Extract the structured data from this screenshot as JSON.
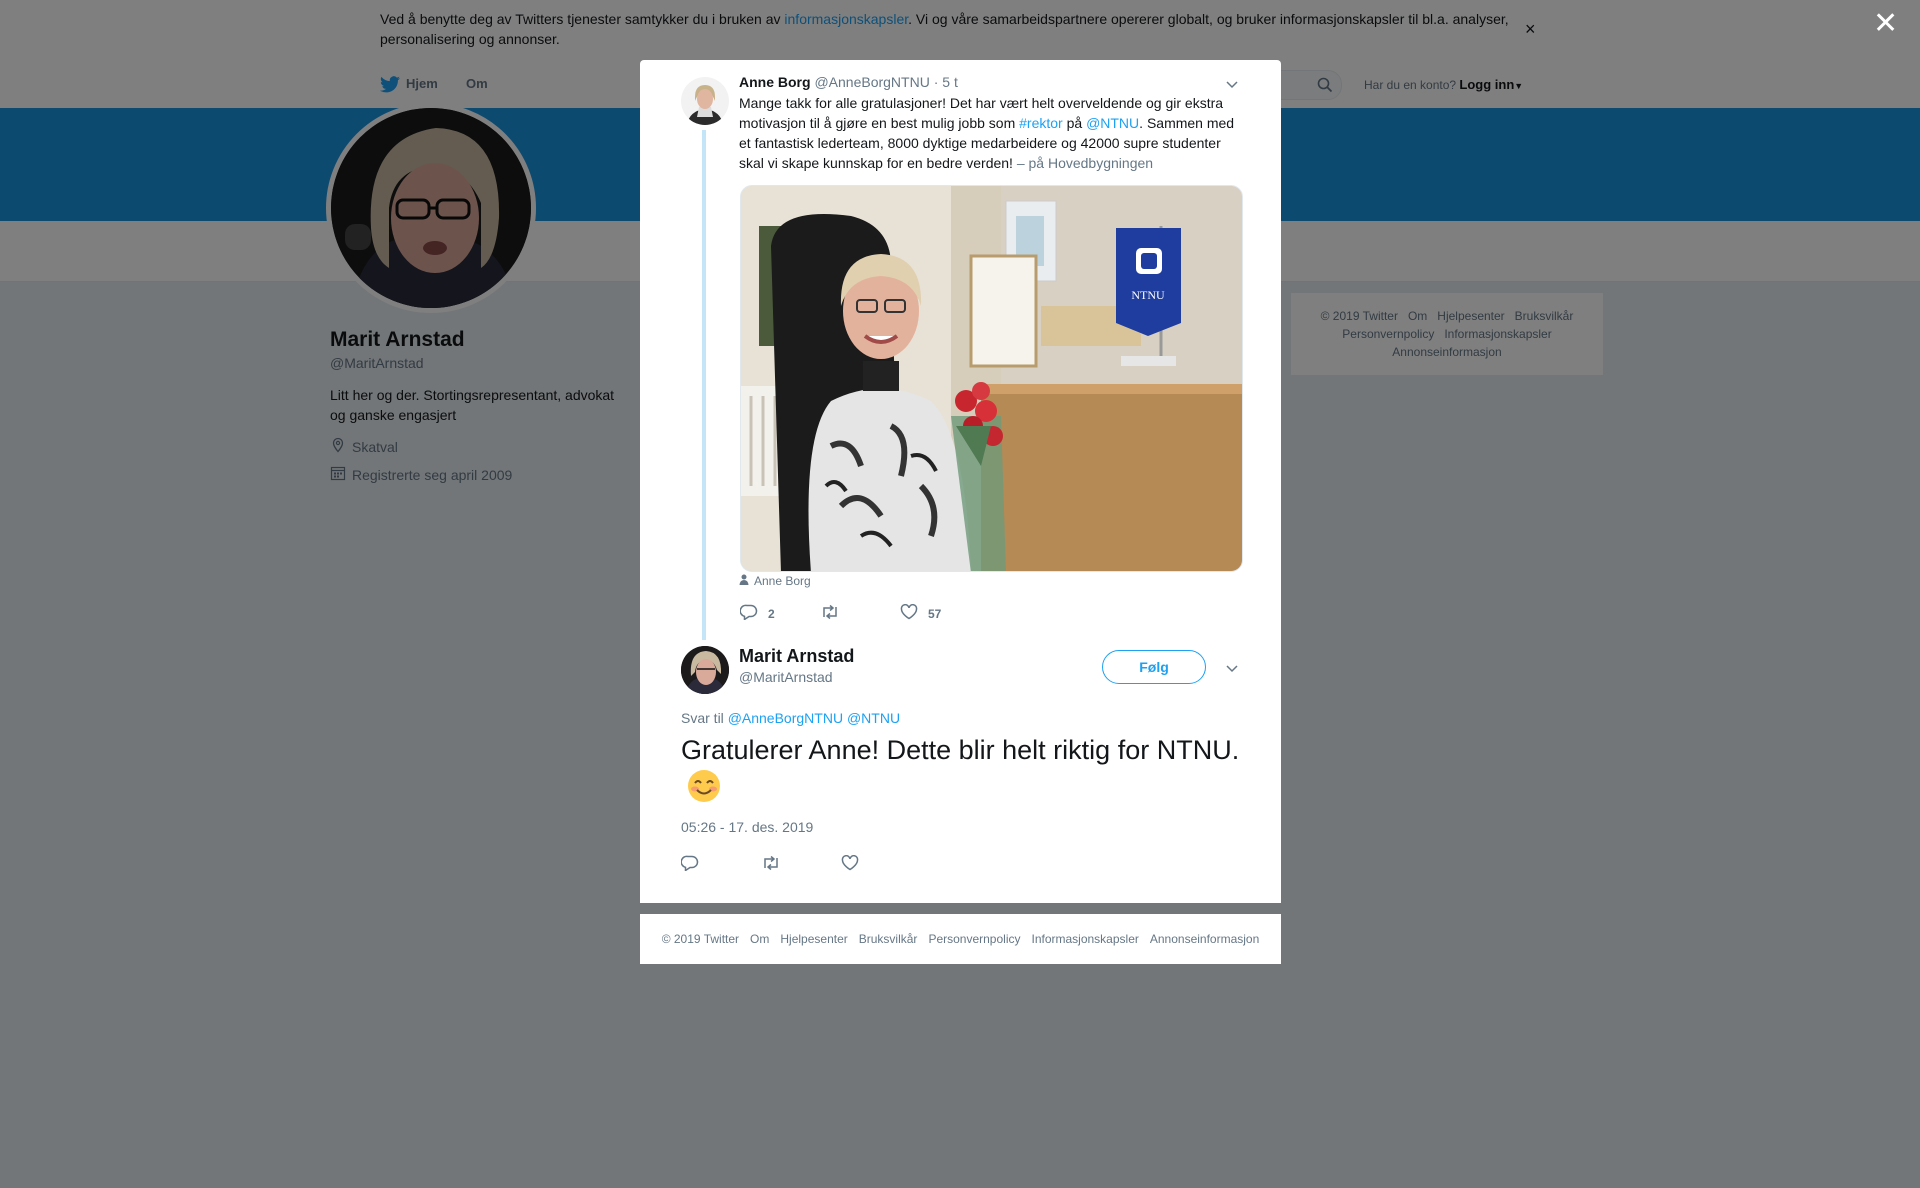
{
  "colors": {
    "accent": "#1da1f2",
    "banner": "#1b95e0",
    "overlay": "rgba(0,0,0,0.5)",
    "muted": "#657786"
  },
  "cookie": {
    "text_before": "Ved å benytte deg av Twitters tjenester samtykker du i bruken av ",
    "link": "informasjonskapsler",
    "text_after": ". Vi og våre samarbeidspartnere opererer globalt, og bruker informasjonskapsler til bl.a. analyser, personalisering og annonser.",
    "close_icon": "×"
  },
  "nav": {
    "home": "Hjem",
    "about": "Om",
    "account_prompt": "Har du en konto?",
    "login": "Logg inn"
  },
  "profile": {
    "name": "Marit Arnstad",
    "handle": "@MaritArnstad",
    "bio": "Litt her og der. Stortingsrepresentant, advokat og ganske engasjert",
    "location": "Skatval",
    "joined": "Registrerte seg april 2009"
  },
  "side_footer": {
    "line1": [
      "© 2019 Twitter",
      "Om",
      "Hjelpesenter",
      "Bruksvilkår"
    ],
    "line2": [
      "Personvernpolicy",
      "Informasjonskapsler"
    ],
    "line3": [
      "Annonseinformasjon"
    ]
  },
  "overlay": {
    "close_icon": "✕"
  },
  "parent_tweet": {
    "name": "Anne Borg",
    "handle": "@AnneBorgNTNU",
    "time": "· 5 t",
    "text_1": "Mange takk for alle gratulasjoner! Det har vært helt overveldende og gir ekstra motivasjon til å gjøre en best mulig jobb som ",
    "hashtag": "#rektor",
    "text_2": " på ",
    "mention": "@NTNU",
    "text_3": ". Sammen med et fantastisk lederteam,  8000 dyktige medarbeidere og 42000 supre studenter skal vi skape kunnskap for en bedre verden! ",
    "place": "– på Hovedbygningen",
    "photo_tag": "Anne Borg",
    "flag_text": "NTNU",
    "replies": "2",
    "likes": "57"
  },
  "focused_tweet": {
    "name": "Marit Arnstad",
    "handle": "@MaritArnstad",
    "follow_label": "Følg",
    "reply_prefix": "Svar til",
    "reply_to_1": "@AnneBorgNTNU",
    "reply_to_2": "@NTNU",
    "text": "Gratulerer Anne! Dette blir helt riktig for NTNU.",
    "timestamp": "05:26 - 17. des. 2019"
  },
  "modal_footer": [
    "© 2019 Twitter",
    "Om",
    "Hjelpesenter",
    "Bruksvilkår",
    "Personvernpolicy",
    "Informasjonskapsler",
    "Annonseinformasjon"
  ]
}
